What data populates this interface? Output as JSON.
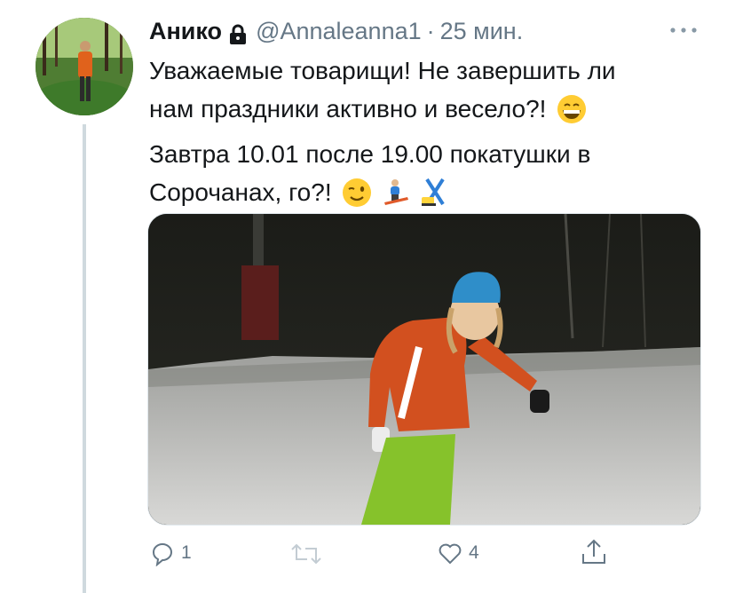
{
  "tweet": {
    "author_name": "Анико",
    "handle": "@Annaleanna1",
    "separator": "·",
    "time": "25 мин.",
    "lines": [
      "Уважаемые товарищи! Не завершить ли",
      "нам праздники активно и весело?!",
      "Завтра 10.01 после 19.00 покатушки в",
      "Сорочанах, го?!"
    ],
    "icons": {
      "lock": "lock-icon",
      "more": "more-icon",
      "grin": "grinning-face-emoji",
      "wink": "winking-face-emoji",
      "snowboarder": "snowboarder-emoji",
      "ski": "ski-emoji"
    }
  },
  "actions": {
    "reply_count": "1",
    "retweet_count": "",
    "like_count": "4"
  },
  "colors": {
    "muted": "#657786",
    "thread_line": "#cfd9de"
  }
}
